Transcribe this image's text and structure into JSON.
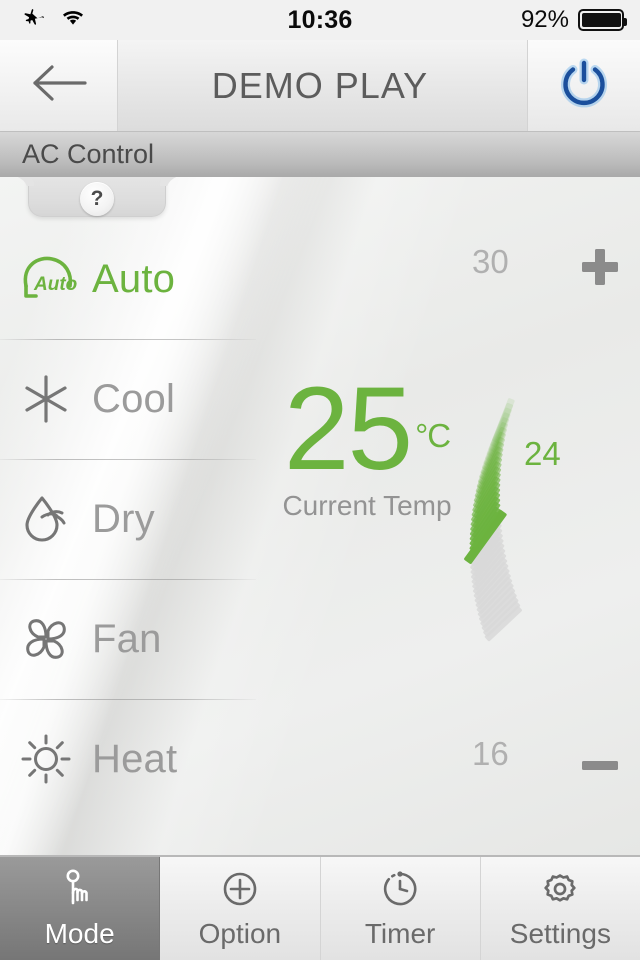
{
  "statusbar": {
    "airplane_icon": "airplane-icon",
    "wifi_icon": "wifi-icon",
    "time": "10:36",
    "battery_percent": "92%",
    "battery_level": 92
  },
  "navbar": {
    "back_icon": "back-arrow-icon",
    "title": "DEMO PLAY",
    "power_icon": "power-icon",
    "power_color": "#1b4f9c"
  },
  "subheader": {
    "label": "AC Control"
  },
  "help_tab": {
    "label": "?"
  },
  "modes": {
    "selected": "Auto",
    "items": [
      {
        "label": "Auto",
        "icon": "auto-head-icon",
        "active": true
      },
      {
        "label": "Cool",
        "icon": "snowflake-icon",
        "active": false
      },
      {
        "label": "Dry",
        "icon": "water-drop-icon",
        "active": false
      },
      {
        "label": "Fan",
        "icon": "fan-blades-icon",
        "active": false
      },
      {
        "label": "Heat",
        "icon": "sun-icon",
        "active": false
      }
    ]
  },
  "temperature": {
    "current_value": "25",
    "unit": "°C",
    "caption": "Current Temp",
    "accent_color": "#6cb33f"
  },
  "slider": {
    "max_label": "30",
    "min_label": "16",
    "setpoint_label": "24",
    "max_value": 30,
    "min_value": 16,
    "setpoint_value": 24,
    "increase_icon": "plus-icon",
    "decrease_icon": "minus-icon"
  },
  "tabbar": {
    "items": [
      {
        "label": "Mode",
        "icon": "hand-tap-icon",
        "active": true
      },
      {
        "label": "Option",
        "icon": "plus-circle-icon",
        "active": false
      },
      {
        "label": "Timer",
        "icon": "clock-icon",
        "active": false
      },
      {
        "label": "Settings",
        "icon": "gear-icon",
        "active": false
      }
    ]
  }
}
